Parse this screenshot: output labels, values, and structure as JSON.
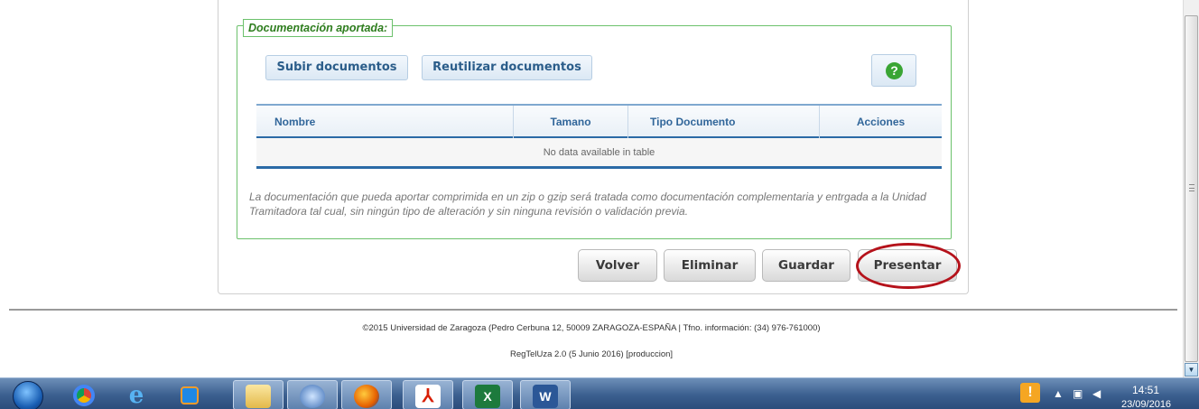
{
  "documentation": {
    "legend": "Documentación aportada:",
    "upload_button": "Subir documentos",
    "reuse_button": "Reutilizar documentos",
    "help_symbol": "?",
    "table": {
      "columns": [
        "Nombre",
        "Tamano",
        "Tipo Documento",
        "Acciones"
      ],
      "empty_message": "No data available in table"
    },
    "note": "La documentación que pueda aportar comprimida en un zip o gzip será tratada como documentación complementaria y entrgada a la Unidad Tramitadora tal cual, sin ningún tipo de alteración y sin ninguna revisión o validación previa."
  },
  "actions": {
    "back": "Volver",
    "delete": "Eliminar",
    "save": "Guardar",
    "submit": "Presentar"
  },
  "footer": {
    "line1": "©2015 Universidad de Zaragoza (Pedro Cerbuna 12, 50009 ZARAGOZA-ESPAÑA | Tfno. información: (34) 976-761000)",
    "line2": "RegTelUza 2.0 (5 Junio 2016) [produccion]"
  },
  "taskbar": {
    "apps": [
      {
        "icon": "chrome-icon",
        "label": ""
      },
      {
        "icon": "internet-explorer-icon",
        "label": "e"
      },
      {
        "icon": "media-player-icon",
        "label": ""
      },
      {
        "icon": "file-explorer-icon",
        "label": ""
      },
      {
        "icon": "thunderbird-icon",
        "label": ""
      },
      {
        "icon": "firefox-icon",
        "label": ""
      },
      {
        "icon": "pdf-reader-icon",
        "label": "⅄"
      },
      {
        "icon": "excel-icon",
        "label": "X"
      },
      {
        "icon": "word-icon",
        "label": "W"
      }
    ],
    "clock_time": "14:51",
    "clock_date": "23/09/2016"
  },
  "colors": {
    "fieldset_border": "#6cc16c",
    "table_accent": "#2b6aa6",
    "highlight_ring": "#b5121b"
  }
}
